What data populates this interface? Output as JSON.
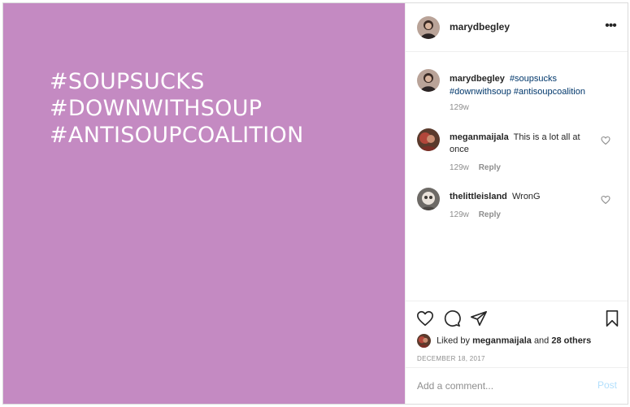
{
  "post": {
    "media_lines": [
      "#SOUPSUCKS",
      "#DOWNWITHSOUP",
      "#ANTISOUPCOALITION"
    ],
    "media_background": "#c48ac2"
  },
  "header": {
    "username": "marydbegley",
    "more_icon": "more-horizontal-icon"
  },
  "caption": {
    "username": "marydbegley",
    "hashtags": [
      "#soupsucks",
      "#downwithsoup",
      "#antisoupcoalition"
    ],
    "time": "129w"
  },
  "comments": [
    {
      "username": "meganmaijala",
      "text": "This is a lot all at once",
      "time": "129w",
      "reply_label": "Reply"
    },
    {
      "username": "thelittleisland",
      "text": "WronG",
      "time": "129w",
      "reply_label": "Reply"
    }
  ],
  "actions": {
    "icons": [
      "heart-icon",
      "comment-icon",
      "share-icon",
      "bookmark-icon"
    ]
  },
  "likes": {
    "prefix": "Liked by",
    "user": "meganmaijala",
    "conjunction": "and",
    "others": "28 others"
  },
  "date": "DECEMBER 18, 2017",
  "add_comment": {
    "placeholder": "Add a comment...",
    "post_label": "Post"
  },
  "colors": {
    "hashtag": "#00376b",
    "post_disabled": "#b2dffc",
    "muted": "#8e8e8e"
  }
}
